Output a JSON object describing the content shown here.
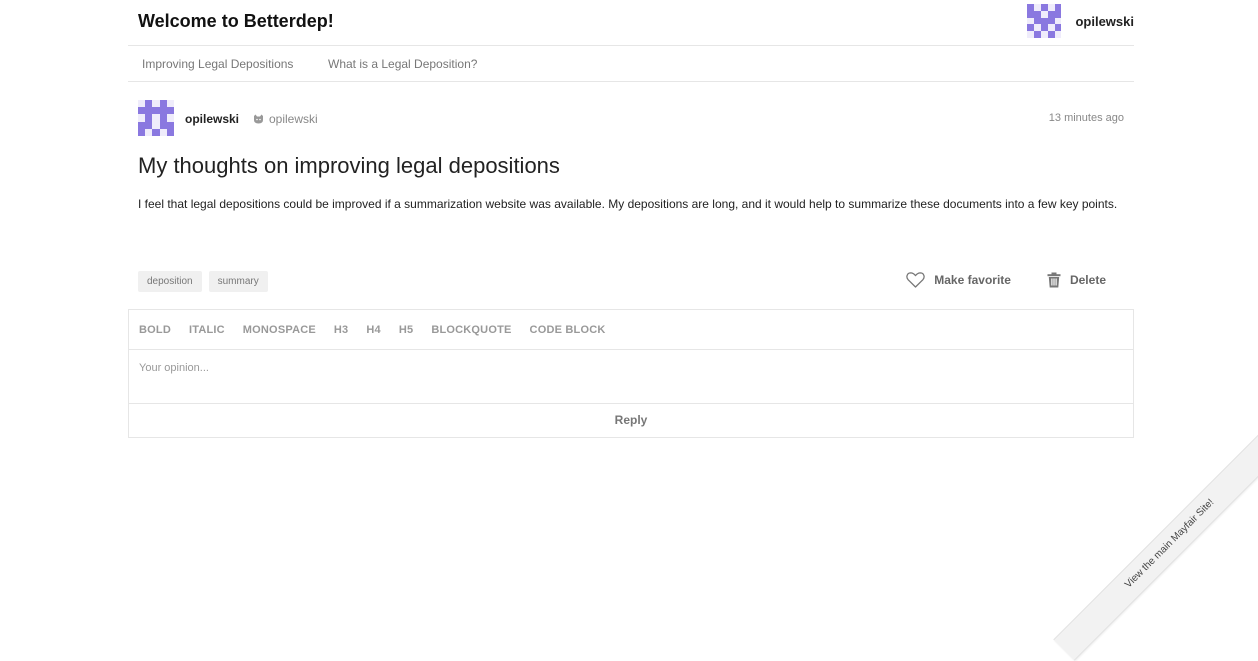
{
  "header": {
    "site_title": "Welcome to Betterdep!",
    "username": "opilewski"
  },
  "nav": {
    "items": [
      {
        "label": "Improving Legal Depositions"
      },
      {
        "label": "What is a Legal Deposition?"
      }
    ]
  },
  "post": {
    "author": "opilewski",
    "github_handle": "opilewski",
    "time_ago": "13 minutes ago",
    "title": "My thoughts on improving legal depositions",
    "body": "I feel that legal depositions could be improved if a summarization website was available. My depositions are long, and it would help to summarize these documents into a few key points.",
    "tags": [
      "deposition",
      "summary"
    ],
    "actions": {
      "favorite_label": "Make favorite",
      "delete_label": "Delete"
    }
  },
  "editor": {
    "toolbar": [
      "BOLD",
      "ITALIC",
      "MONOSPACE",
      "H3",
      "H4",
      "H5",
      "BLOCKQUOTE",
      "CODE BLOCK"
    ],
    "placeholder": "Your opinion...",
    "reply_label": "Reply"
  },
  "ribbon": {
    "label": "View the main Mayfair Site!"
  },
  "colors": {
    "avatar": "#8a78e0",
    "avatar_bg": "#efecfb"
  }
}
